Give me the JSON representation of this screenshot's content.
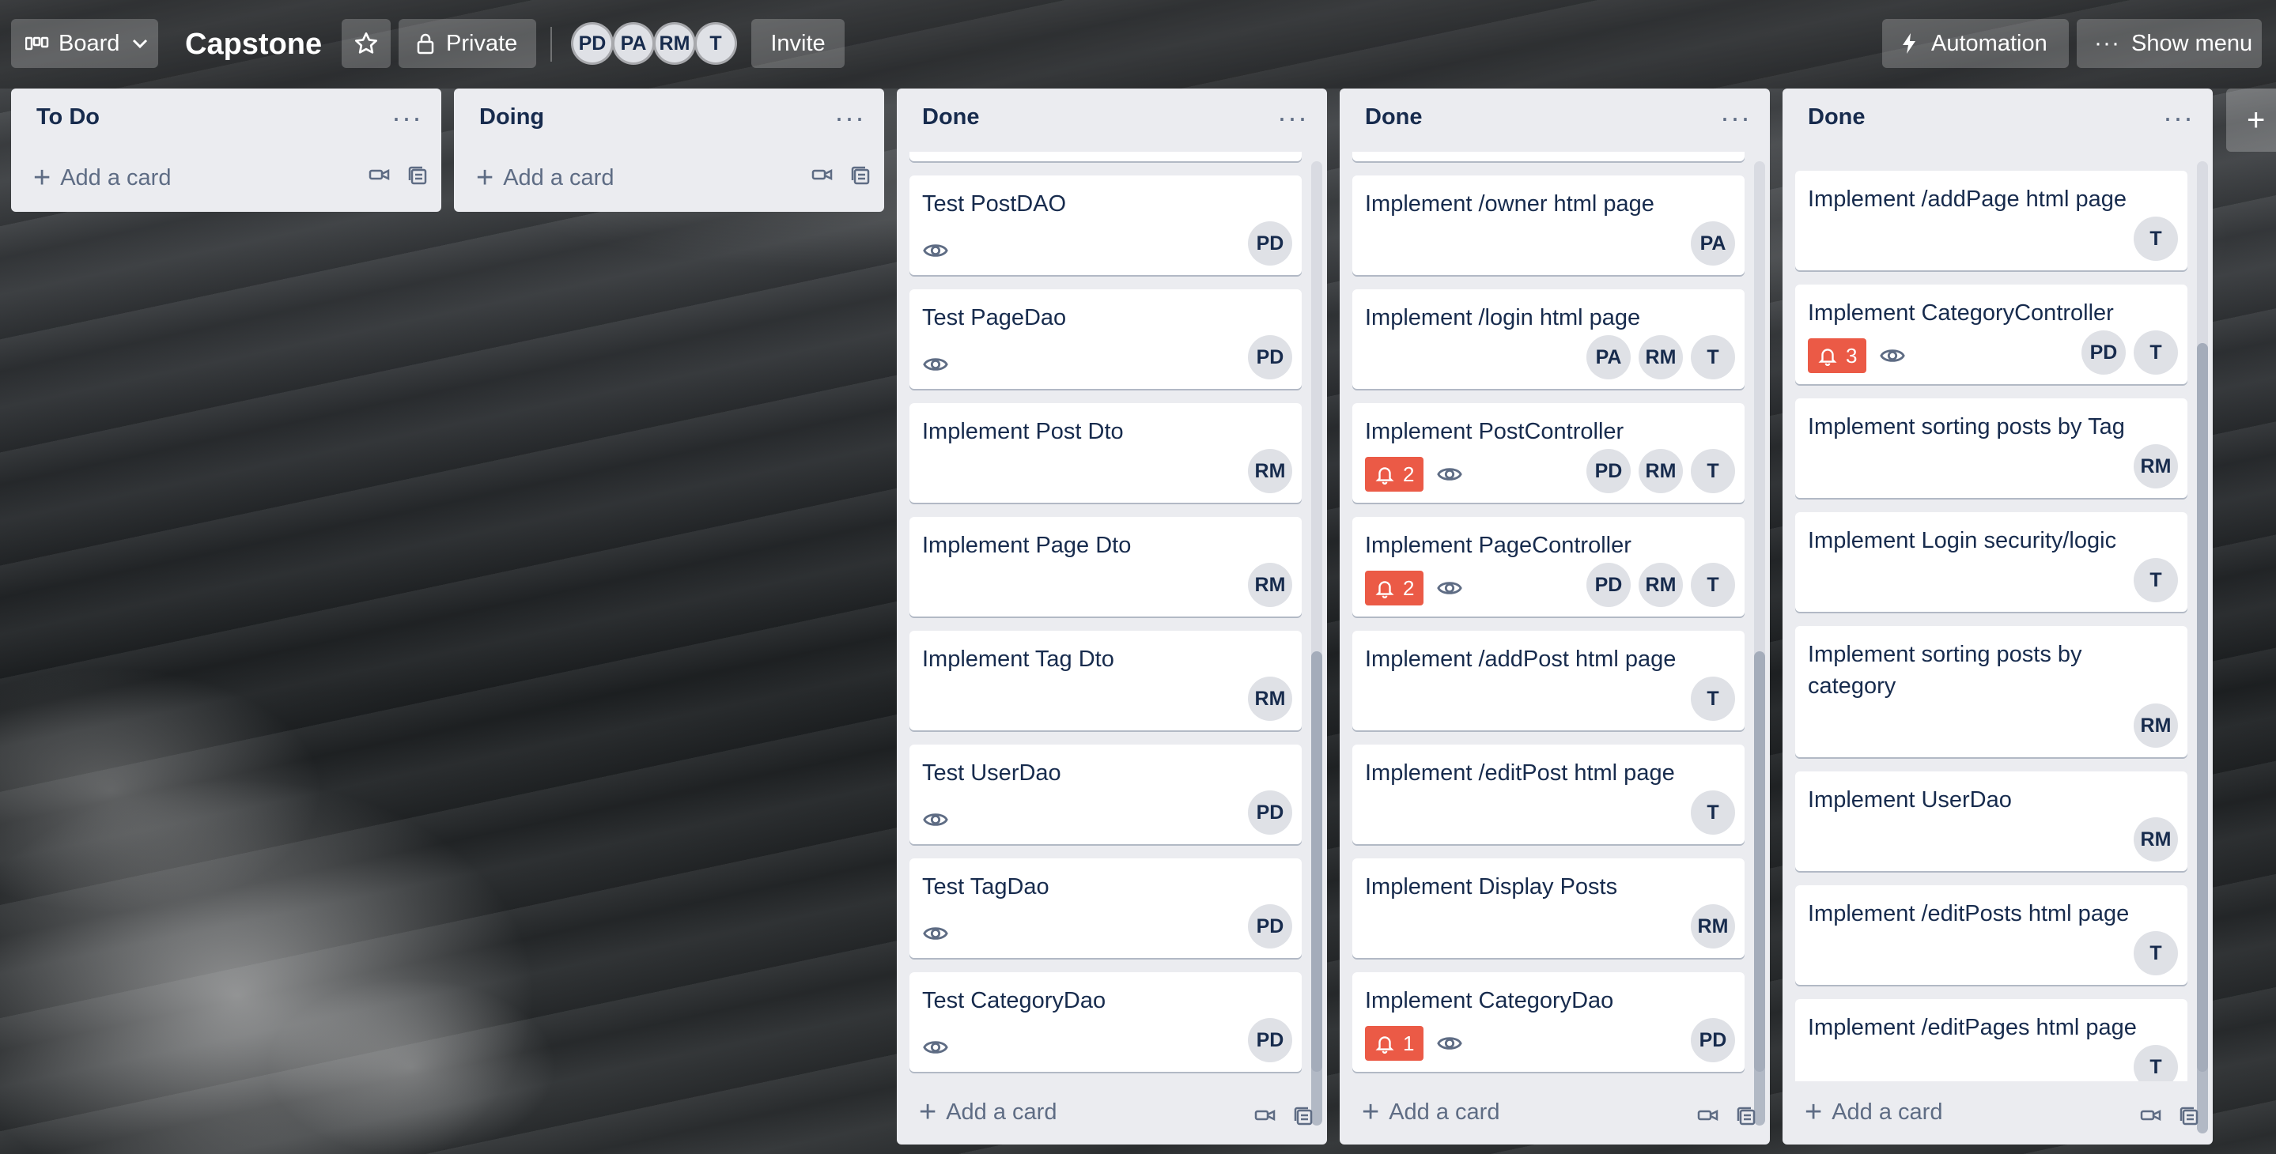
{
  "header": {
    "view_switcher_label": "Board",
    "board_title": "Capstone",
    "visibility_label": "Private",
    "members": [
      "PD",
      "PA",
      "RM",
      "T"
    ],
    "invite_label": "Invite",
    "automation_label": "Automation",
    "show_menu_label": "Show menu"
  },
  "lists": [
    {
      "title": "To Do",
      "add_card_label": "Add a card",
      "cards": []
    },
    {
      "title": "Doing",
      "add_card_label": "Add a card",
      "cards": []
    },
    {
      "title": "Done",
      "add_card_label": "Add a card",
      "cards": [
        {
          "title": "Test PostDAO",
          "watch": true,
          "notifications": "",
          "members": [
            "PD"
          ]
        },
        {
          "title": "Test PageDao",
          "watch": true,
          "notifications": "",
          "members": [
            "PD"
          ]
        },
        {
          "title": "Implement Post Dto",
          "watch": false,
          "notifications": "",
          "members": [
            "RM"
          ]
        },
        {
          "title": "Implement Page Dto",
          "watch": false,
          "notifications": "",
          "members": [
            "RM"
          ]
        },
        {
          "title": "Implement Tag Dto",
          "watch": false,
          "notifications": "",
          "members": [
            "RM"
          ]
        },
        {
          "title": "Test UserDao",
          "watch": true,
          "notifications": "",
          "members": [
            "PD"
          ]
        },
        {
          "title": "Test TagDao",
          "watch": true,
          "notifications": "",
          "members": [
            "PD"
          ]
        },
        {
          "title": "Test CategoryDao",
          "watch": true,
          "notifications": "",
          "members": [
            "PD"
          ]
        }
      ]
    },
    {
      "title": "Done",
      "add_card_label": "Add a card",
      "cards": [
        {
          "title": "Implement /owner html page",
          "watch": false,
          "notifications": "",
          "members": [
            "PA"
          ]
        },
        {
          "title": "Implement /login html page",
          "watch": false,
          "notifications": "",
          "members": [
            "PA",
            "RM",
            "T"
          ]
        },
        {
          "title": "Implement PostController",
          "watch": true,
          "notifications": "2",
          "members": [
            "PD",
            "RM",
            "T"
          ]
        },
        {
          "title": "Implement PageController",
          "watch": true,
          "notifications": "2",
          "members": [
            "PD",
            "RM",
            "T"
          ]
        },
        {
          "title": "Implement /addPost html page",
          "watch": false,
          "notifications": "",
          "members": [
            "T"
          ]
        },
        {
          "title": "Implement /editPost html page",
          "watch": false,
          "notifications": "",
          "members": [
            "T"
          ]
        },
        {
          "title": "Implement Display Posts",
          "watch": false,
          "notifications": "",
          "members": [
            "RM"
          ]
        },
        {
          "title": "Implement CategoryDao",
          "watch": true,
          "notifications": "1",
          "members": [
            "PD"
          ]
        }
      ]
    },
    {
      "title": "Done",
      "add_card_label": "Add a card",
      "cards": [
        {
          "title": "Implement /addPage html page",
          "watch": false,
          "notifications": "",
          "members": [
            "T"
          ]
        },
        {
          "title": "Implement CategoryController",
          "watch": true,
          "notifications": "3",
          "members": [
            "PD",
            "T"
          ]
        },
        {
          "title": "Implement sorting posts by Tag",
          "watch": false,
          "notifications": "",
          "members": [
            "RM"
          ]
        },
        {
          "title": "Implement Login security/logic",
          "watch": false,
          "notifications": "",
          "members": [
            "T"
          ]
        },
        {
          "title": "Implement sorting posts by category",
          "watch": false,
          "notifications": "",
          "members": [
            "RM"
          ]
        },
        {
          "title": "Implement UserDao",
          "watch": false,
          "notifications": "",
          "members": [
            "RM"
          ]
        },
        {
          "title": "Implement /editPosts html page",
          "watch": false,
          "notifications": "",
          "members": [
            "T"
          ]
        },
        {
          "title": "Implement /editPages html page",
          "watch": false,
          "notifications": "",
          "members": [
            "T"
          ]
        }
      ]
    }
  ],
  "add_list_label": "+",
  "colors": {
    "list_bg": "#ebecf0",
    "card_bg": "#ffffff",
    "notification_badge": "#eb5a46",
    "text_primary": "#172b4d",
    "text_secondary": "#5e6c84"
  }
}
